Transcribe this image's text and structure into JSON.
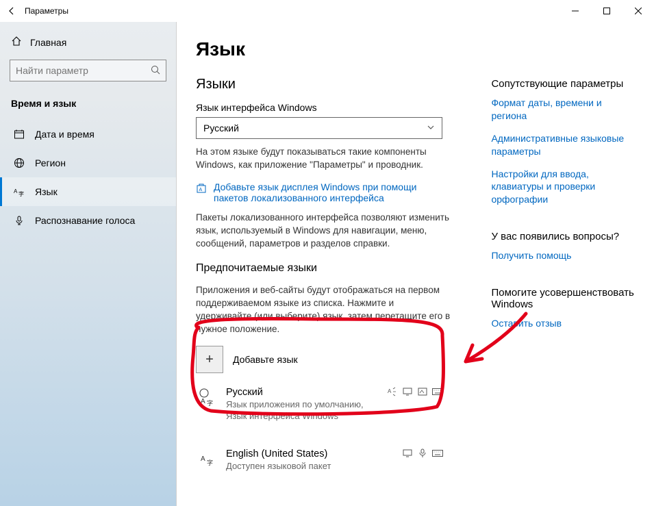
{
  "titlebar": {
    "title": "Параметры"
  },
  "sidebar": {
    "home": "Главная",
    "search_placeholder": "Найти параметр",
    "category": "Время и язык",
    "items": [
      {
        "label": "Дата и время"
      },
      {
        "label": "Регион"
      },
      {
        "label": "Язык"
      },
      {
        "label": "Распознавание голоса"
      }
    ]
  },
  "page": {
    "title": "Язык",
    "languages_heading": "Языки",
    "display_label": "Язык интерфейса Windows",
    "display_value": "Русский",
    "display_desc": "На этом языке будут показываться такие компоненты Windows, как приложение \"Параметры\" и проводник.",
    "lip_link": "Добавьте язык дисплея Windows при помощи пакетов локализованного интерфейса",
    "lip_desc": "Пакеты локализованного интерфейса позволяют изменить язык, используемый в Windows для навигации, меню, сообщений, параметров и разделов справки.",
    "pref_heading": "Предпочитаемые языки",
    "pref_desc": "Приложения и веб-сайты будут отображаться на первом поддерживаемом языке из списка. Нажмите и удерживайте (или выберите) язык, затем перетащите его в нужное положение.",
    "add_label": "Добавьте язык",
    "langs": [
      {
        "name": "Русский",
        "sub": "Язык приложения по умолчанию, Язык интерфейса Windows"
      },
      {
        "name": "English (United States)",
        "sub": "Доступен языковой пакет"
      }
    ]
  },
  "right": {
    "related_heading": "Сопутствующие параметры",
    "related_links": [
      "Формат даты, времени и региона",
      "Административные языковые параметры",
      "Настройки для ввода, клавиатуры и проверки орфографии"
    ],
    "question_heading": "У вас появились вопросы?",
    "question_link": "Получить помощь",
    "feedback_heading": "Помогите усовершенствовать Windows",
    "feedback_link": "Оставить отзыв"
  }
}
